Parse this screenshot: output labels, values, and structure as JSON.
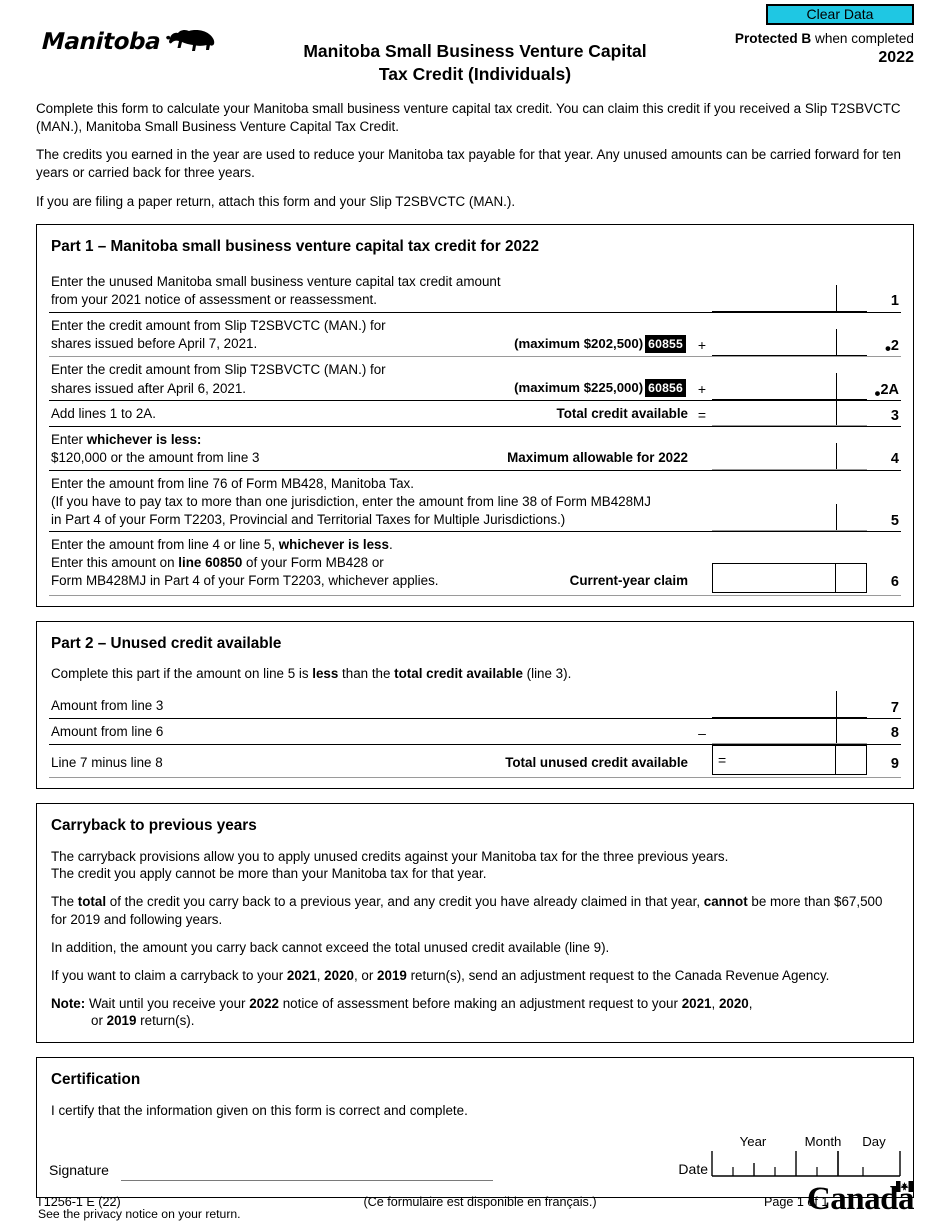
{
  "header": {
    "clear_data_label": "Clear Data",
    "protected_bold": "Protected B",
    "protected_rest": " when completed",
    "tax_year": "2022",
    "province_logo_text": "Manitoba",
    "form_title_line1": "Manitoba Small Business Venture Capital",
    "form_title_line2": "Tax Credit (Individuals)",
    "accent_color": "#1fc7e3"
  },
  "intro": {
    "p1": "Complete this form to calculate your Manitoba small business venture capital tax credit. You can claim this credit if you received a Slip T2SBVCTC (MAN.), Manitoba Small Business Venture Capital Tax Credit.",
    "p2": "The credits you earned in the year are used to reduce your Manitoba tax payable for that year. Any unused amounts can be carried forward for ten years or carried back for three years.",
    "p3": "If you are filing a paper return, attach this form and your Slip T2SBVCTC (MAN.)."
  },
  "part1": {
    "title": "Part 1 – Manitoba small business venture capital tax credit for 2022",
    "rows": [
      {
        "text_line1": "Enter the unused Manitoba small business venture capital tax credit amount",
        "text_line2": "from your 2021 notice of assessment or reassessment.",
        "right_label": "",
        "max_label": "",
        "code": "",
        "operator": "",
        "line_number": "1"
      },
      {
        "text_line1": "Enter the credit amount from Slip T2SBVCTC (MAN.) for",
        "text_line2": "shares issued before April 7, 2021.",
        "right_label": "",
        "max_label": "(maximum $202,500)",
        "code": "60855",
        "operator": "+",
        "line_number": "2",
        "bullet": true
      },
      {
        "text_line1": "Enter the credit amount from Slip T2SBVCTC (MAN.) for",
        "text_line2": "shares issued after April 6, 2021.",
        "right_label": "",
        "max_label": "(maximum $225,000)",
        "code": "60856",
        "operator": "+",
        "line_number": "2A",
        "bullet": true
      },
      {
        "text_line1": "Add lines 1 to 2A.",
        "text_line2": "",
        "right_label": "Total credit available",
        "max_label": "",
        "code": "",
        "operator": "=",
        "line_number": "3"
      },
      {
        "text_line1": "Enter whichever is less:",
        "text_line2": "$120,000 or the amount from line 3",
        "right_label": "Maximum allowable for 2022",
        "max_label": "",
        "code": "",
        "operator": "",
        "line_number": "4"
      },
      {
        "text_line1": "Enter the amount from line 76 of Form MB428, Manitoba Tax.",
        "text_line2": "(If you have to pay tax to more than one jurisdiction, enter the amount from line 38 of Form MB428MJ",
        "text_line3": "in Part 4 of your Form T2203, Provincial and Territorial Taxes for Multiple Jurisdictions.)",
        "right_label": "",
        "max_label": "",
        "code": "",
        "operator": "",
        "line_number": "5"
      },
      {
        "text_line1": "Enter the amount from line 4 or line 5, whichever is less.",
        "text_line2": "Enter this amount on line 60850 of your Form MB428 or",
        "text_line3": "Form MB428MJ in Part 4 of your Form T2203, whichever applies.",
        "right_label": "Current-year claim",
        "max_label": "",
        "code": "",
        "operator": "",
        "line_number": "6",
        "boxed": true
      }
    ]
  },
  "part2": {
    "title": "Part 2 – Unused credit available",
    "intro": "Complete this part if the amount on line 5 is less than the total credit available (line 3).",
    "rows": [
      {
        "text": "Amount from line 3",
        "right_label": "",
        "operator": "",
        "line_number": "7"
      },
      {
        "text": "Amount from line 6",
        "right_label": "",
        "operator": "–",
        "line_number": "8"
      },
      {
        "text": "Line 7 minus line 8",
        "right_label": "Total unused credit available",
        "operator": "=",
        "line_number": "9",
        "boxed": true
      }
    ]
  },
  "carryback": {
    "title": "Carryback to previous years",
    "p1_line1": "The carryback provisions allow you to apply unused credits against your Manitoba tax for the three previous years.",
    "p1_line2": "The credit you apply cannot be more than your Manitoba tax for that year.",
    "p2": "The total of the credit you carry back to a previous year, and any credit you have already claimed in that year, cannot be more than $67,500 for 2019 and following years.",
    "p3": "In addition, the amount you carry back cannot exceed the total unused credit available (line 9).",
    "p4": "If you want to claim a carryback to your 2021, 2020, or 2019 return(s), send an adjustment request to the Canada Revenue Agency.",
    "note_label": "Note:",
    "note_text_line1": " Wait until you receive your 2022 notice of assessment before making an adjustment request to your 2021, 2020,",
    "note_text_line2": "or 2019 return(s)."
  },
  "certification": {
    "title": "Certification",
    "statement": "I certify that the information given on this form is correct and complete.",
    "signature_label": "Signature",
    "date_label": "Date",
    "year_label": "Year",
    "month_label": "Month",
    "day_label": "Day"
  },
  "privacy_note": "See the privacy notice on your return.",
  "footer": {
    "form_code": "T1256-1 E (22)",
    "french_note": "(Ce formulaire est disponible en français.)",
    "page_label": "Page 1 of 1",
    "canada_wordmark": "Canada"
  }
}
